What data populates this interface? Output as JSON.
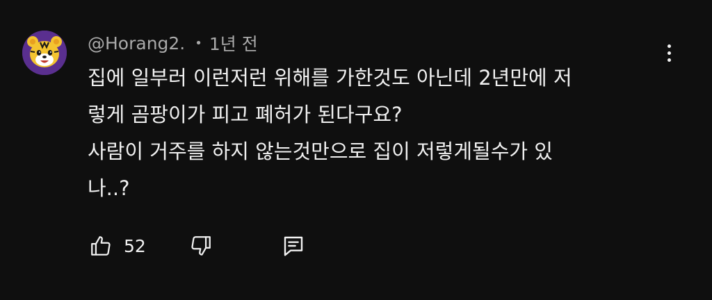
{
  "comment": {
    "author": "@Horang2.",
    "separator": "•",
    "timestamp": "1년 전",
    "text_line_1": "집에 일부러 이런저런 위해를 가한것도 아닌데 2년만에 저",
    "text_line_2": "렇게 곰팡이가 피고 폐허가 된다구요?",
    "text_line_3": "사람이 거주를 하지 않는것만으로 집이 저렇게될수가 있",
    "text_line_4": "나..?"
  },
  "actions": {
    "like_count": "52"
  },
  "icons": {
    "avatar": "tiger-avatar-icon",
    "like": "thumbs-up-icon",
    "dislike": "thumbs-down-icon",
    "reply": "reply-comment-icon",
    "more": "more-vertical-icon"
  },
  "colors": {
    "background": "#0f0f0f",
    "primary_text": "#f1f1f1",
    "secondary_text": "#aaaaaa",
    "avatar_bg": "#5a2f8f"
  }
}
